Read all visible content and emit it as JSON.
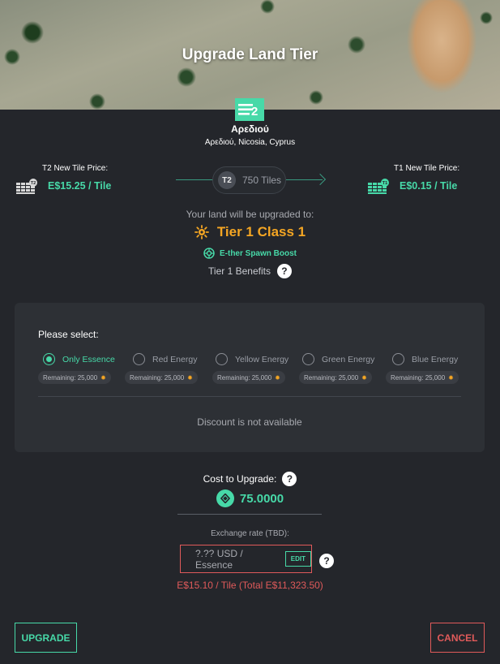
{
  "header": {
    "title": "Upgrade Land Tier"
  },
  "land": {
    "name": "Αρεδιού",
    "location": "Αρεδιού, Nicosia, Cyprus",
    "icon": "land-tier-2-icon",
    "tier_badge_label": "2"
  },
  "current_price": {
    "label": "T2 New Tile Price:",
    "value": "E$15.25 / Tile",
    "icon": "tile-stack-icon",
    "badge": "T2"
  },
  "new_price": {
    "label": "T1 New Tile Price:",
    "value": "E$0.15 / Tile",
    "icon": "tile-stack-icon",
    "badge": "T1"
  },
  "tiles": {
    "badge": "T2",
    "count": "750 Tiles"
  },
  "upgrade": {
    "intro": "Your land will be upgraded to:",
    "tier_name": "Tier 1 Class 1",
    "tier_icon": "sun-badge-icon",
    "boost_label": "E-ther Spawn Boost",
    "boost_icon": "boost-icon",
    "benefits_label": "Tier 1 Benefits",
    "help_glyph": "?"
  },
  "selection": {
    "prompt": "Please select:",
    "options": [
      {
        "label": "Only Essence",
        "remaining": "Remaining: 25,000",
        "selected": true
      },
      {
        "label": "Red Energy",
        "remaining": "Remaining: 25,000",
        "selected": false
      },
      {
        "label": "Yellow Energy",
        "remaining": "Remaining: 25,000",
        "selected": false
      },
      {
        "label": "Green Energy",
        "remaining": "Remaining: 25,000",
        "selected": false
      },
      {
        "label": "Blue Energy",
        "remaining": "Remaining: 25,000",
        "selected": false
      }
    ],
    "discount_text": "Discount is not available"
  },
  "cost": {
    "label": "Cost to Upgrade:",
    "value": "75.0000",
    "exchange_label": "Exchange rate (TBD):",
    "exchange_value": "?.?? USD / Essence",
    "edit_label": "EDIT",
    "total_text": "E$15.10 / Tile (Total E$11,323.50)"
  },
  "actions": {
    "upgrade_label": "UPGRADE",
    "cancel_label": "CANCEL"
  },
  "colors": {
    "accent": "#47d9a8",
    "tier": "#f5a623",
    "danger": "#e05a5a",
    "background": "#24262b",
    "panel": "#2d3035"
  }
}
